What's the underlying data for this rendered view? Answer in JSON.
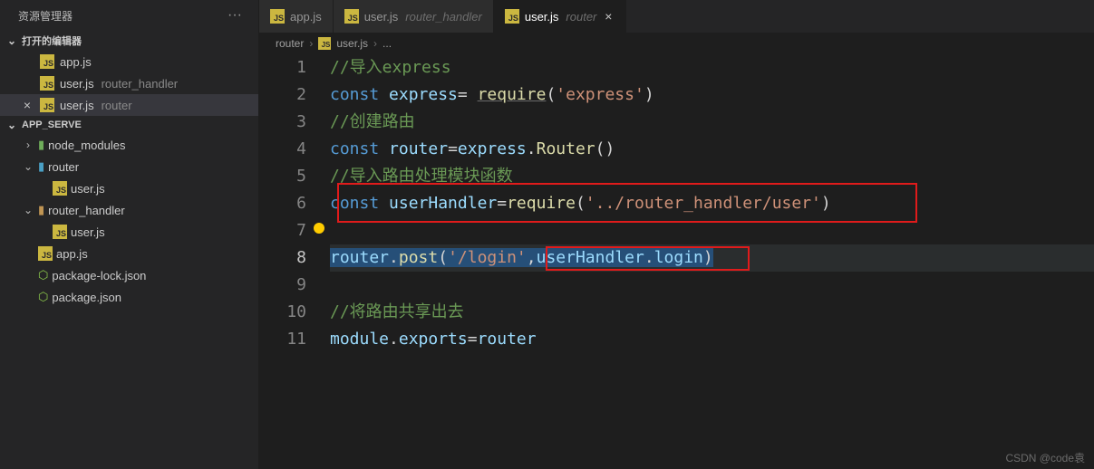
{
  "sidebar": {
    "title": "资源管理器",
    "open_editors_label": "打开的编辑器",
    "open_editors": [
      {
        "name": "app.js",
        "folder": "",
        "active": false
      },
      {
        "name": "user.js",
        "folder": "router_handler",
        "active": false
      },
      {
        "name": "user.js",
        "folder": "router",
        "active": true
      }
    ],
    "project_label": "APP_SERVE",
    "tree": {
      "node_modules": "node_modules",
      "router": "router",
      "router_user": "user.js",
      "router_handler": "router_handler",
      "rh_user": "user.js",
      "app_js": "app.js",
      "pkg_lock": "package-lock.json",
      "pkg": "package.json"
    }
  },
  "tabs": [
    {
      "name": "app.js",
      "folder": "",
      "active": false
    },
    {
      "name": "user.js",
      "folder": "router_handler",
      "active": false
    },
    {
      "name": "user.js",
      "folder": "router",
      "active": true
    }
  ],
  "breadcrumbs": {
    "a": "router",
    "b": "user.js",
    "c": "..."
  },
  "code": {
    "l1": "//导入express",
    "l2_const": "const ",
    "l2_id": "express",
    "l2_eq": "= ",
    "l2_fn": "require",
    "l2_open": "(",
    "l2_str": "'express'",
    "l2_close": ")",
    "l3": "//创建路由",
    "l4_const": "const ",
    "l4_id": "router",
    "l4_eq": "=",
    "l4_e": "express",
    "l4_dot": ".",
    "l4_R": "Router",
    "l4_p": "()",
    "l5": "//导入路由处理模块函数",
    "l6_const": "const ",
    "l6_id": "userHandler",
    "l6_eq": "=",
    "l6_fn": "require",
    "l6_open": "(",
    "l6_str": "'../router_handler/user'",
    "l6_close": ")",
    "l8_r": "router",
    "l8_dot": ".",
    "l8_post": "post",
    "l8_open": "(",
    "l8_str": "'/login'",
    "l8_c": ",",
    "l8_uh": "userHandler",
    "l8_dot2": ".",
    "l8_login": "login",
    "l8_close": ")",
    "l10": "//将路由共享出去",
    "l11_m": "module",
    "l11_dot": ".",
    "l11_exp": "exports",
    "l11_eq": "=",
    "l11_r": "router"
  },
  "watermark": "CSDN @code袁"
}
